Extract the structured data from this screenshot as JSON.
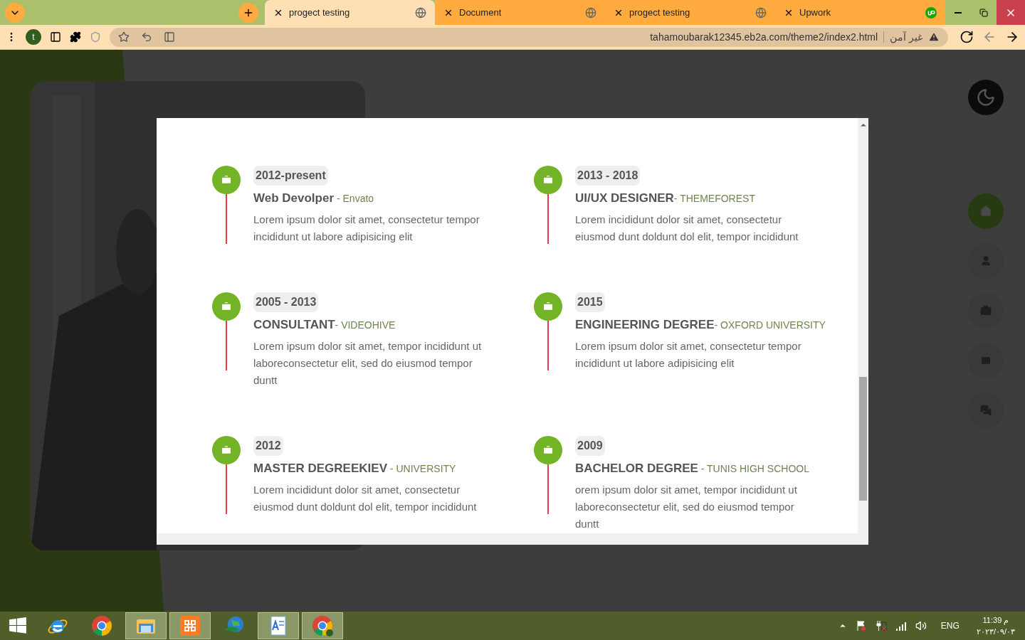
{
  "browser": {
    "tabs": [
      {
        "title": "progect testing",
        "selected": true,
        "kind": "globe"
      },
      {
        "title": "Document",
        "selected": false,
        "kind": "globe"
      },
      {
        "title": "progect testing",
        "selected": false,
        "kind": "globe"
      },
      {
        "title": "Upwork",
        "selected": false,
        "kind": "upwork"
      }
    ],
    "profile_initial": "t",
    "url": "tahamoubarak12345.eb2a.com/theme2/index2.html",
    "security": "غير آمن"
  },
  "timeline": [
    {
      "period": "2012-present",
      "title": "Web Devolper",
      "subtitle": " - Envato",
      "text": "Lorem ipsum dolor sit amet, consectetur tempor incididunt ut labore adipisicing elit"
    },
    {
      "period": "2013 - 2018",
      "title": "UI/UX DESIGNER",
      "subtitle": "- THEMEFOREST",
      "text": "Lorem incididunt dolor sit amet, consectetur eiusmod dunt doldunt dol elit, tempor incididunt"
    },
    {
      "period": "2005 - 2013",
      "title": "CONSULTANT",
      "subtitle": "- VIDEOHIVE",
      "text": "Lorem ipsum dolor sit amet, tempor incididunt ut laboreconsectetur elit, sed do eiusmod tempor duntt"
    },
    {
      "period": "2015",
      "title": "ENGINEERING DEGREE",
      "subtitle": "- OXFORD UNIVERSITY",
      "text": "Lorem ipsum dolor sit amet, consectetur tempor incididunt ut labore adipisicing elit"
    },
    {
      "period": "2012",
      "title": "MASTER DEGREEKIEV",
      "subtitle": " - UNIVERSITY",
      "text": "Lorem incididunt dolor sit amet, consectetur eiusmod dunt doldunt dol elit, tempor incididunt"
    },
    {
      "period": "2009",
      "title": "BACHELOR DEGREE",
      "subtitle": " - TUNIS HIGH SCHOOL",
      "text": "orem ipsum dolor sit amet, tempor incididunt ut laboreconsectetur elit, sed do eiusmod tempor duntt"
    }
  ],
  "nav": [
    {
      "kind": "home",
      "selected": true
    },
    {
      "kind": "user",
      "selected": false
    },
    {
      "kind": "briefcase",
      "selected": false
    },
    {
      "kind": "mail",
      "selected": false
    },
    {
      "kind": "chat",
      "selected": false
    }
  ],
  "taskbar": {
    "apps": [
      {
        "kind": "ie",
        "running": false
      },
      {
        "kind": "chrome",
        "running": false
      },
      {
        "kind": "folder",
        "running": true
      },
      {
        "kind": "xampp",
        "running": true
      },
      {
        "kind": "globe",
        "running": false
      },
      {
        "kind": "wordpad",
        "running": true
      },
      {
        "kind": "chrome-profile",
        "running": true
      }
    ],
    "language": "ENG",
    "time": "11:39 م",
    "date": "٢٠٢٣/٠٩/٠٣"
  }
}
